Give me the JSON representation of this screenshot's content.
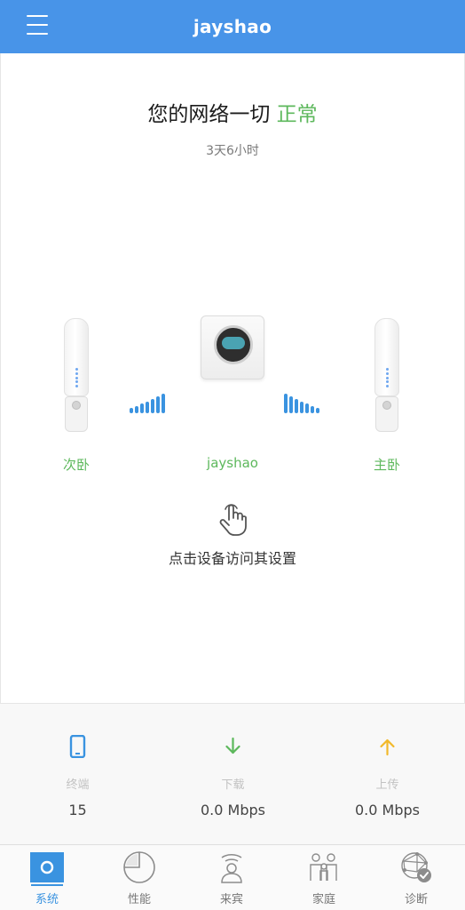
{
  "header": {
    "title": "jayshao",
    "menu_icon": "hamburger-menu-icon"
  },
  "status": {
    "prefix": "您的网络一切",
    "state": "正常",
    "state_color": "#5db85c",
    "uptime": "3天6小时"
  },
  "devices": {
    "left": {
      "label": "次卧",
      "icon": "satellite-device-icon"
    },
    "center": {
      "label": "jayshao",
      "icon": "router-device-icon"
    },
    "right": {
      "label": "主卧",
      "icon": "satellite-device-icon"
    }
  },
  "hint": {
    "text": "点击设备访问其设置",
    "icon": "tap-hand-icon"
  },
  "stats": [
    {
      "label": "终端",
      "value": "15",
      "icon": "phone-icon",
      "color": "#3a93e0"
    },
    {
      "label": "下载",
      "value": "0.0 Mbps",
      "icon": "download-arrow-icon",
      "color": "#5db85c"
    },
    {
      "label": "上传",
      "value": "0.0 Mbps",
      "icon": "upload-arrow-icon",
      "color": "#f2b92b"
    }
  ],
  "nav": {
    "active": "系统",
    "items": [
      {
        "label": "系统",
        "icon": "system-icon"
      },
      {
        "label": "性能",
        "icon": "performance-pie-icon"
      },
      {
        "label": "来宾",
        "icon": "guest-icon"
      },
      {
        "label": "家庭",
        "icon": "family-icon"
      },
      {
        "label": "诊断",
        "icon": "diagnostics-icon"
      }
    ]
  },
  "colors": {
    "brand_blue": "#4894e8",
    "accent_blue": "#3a93e0",
    "ok_green": "#5db85c"
  }
}
